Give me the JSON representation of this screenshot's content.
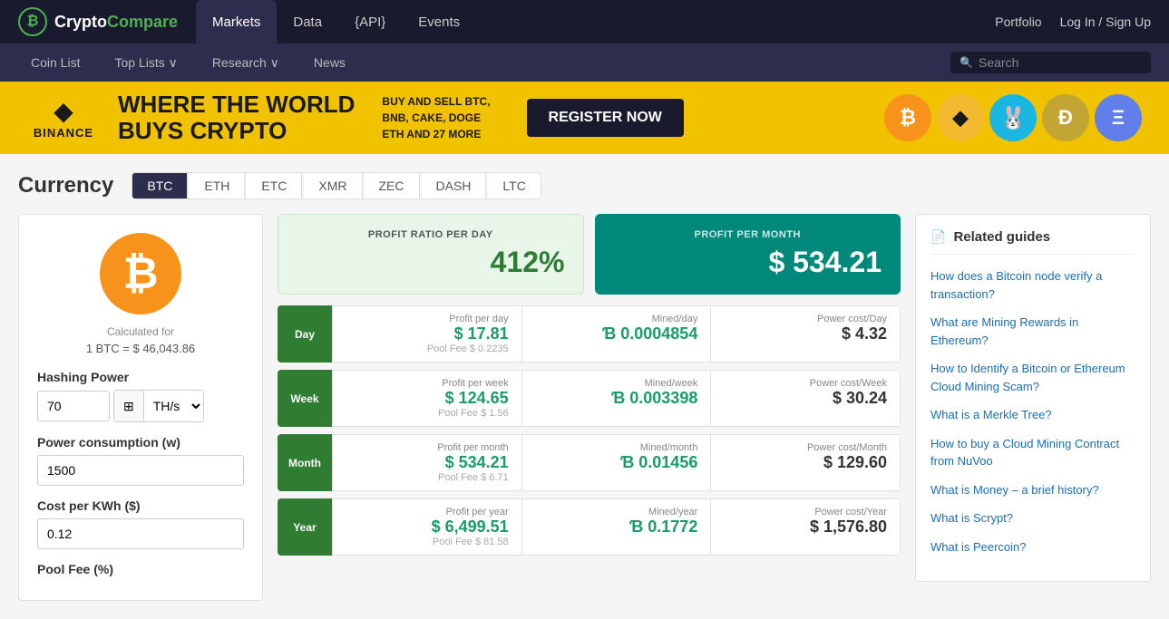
{
  "topNav": {
    "logo": "CryptoCompare",
    "logoPart1": "Crypto",
    "logoPart2": "Compare",
    "logoIcon": "₿",
    "items": [
      {
        "label": "Markets",
        "active": true
      },
      {
        "label": "Data",
        "active": false
      },
      {
        "label": "{API}",
        "active": false
      },
      {
        "label": "Events",
        "active": false
      }
    ],
    "rightLinks": [
      {
        "label": "Portfolio"
      },
      {
        "label": "Log In / Sign Up"
      }
    ]
  },
  "secondaryNav": {
    "items": [
      {
        "label": "Coin List"
      },
      {
        "label": "Top Lists ∨"
      },
      {
        "label": "Research ∨"
      },
      {
        "label": "News"
      }
    ],
    "search": {
      "placeholder": "Search"
    }
  },
  "banner": {
    "brand": "BINANCE",
    "brandIcon": "◆",
    "headline1": "WHERE THE WORLD",
    "headline2": "BUYS CRYPTO",
    "sub": "BUY AND SELL BTC,\nBNB, CAKE, DOGE\nETH AND 27 MORE",
    "cta": "REGISTER NOW",
    "coins": [
      {
        "symbol": "₿",
        "bg": "#f7931a",
        "color": "#fff"
      },
      {
        "symbol": "◆",
        "bg": "#f3ba2f",
        "color": "#1a1a1a"
      },
      {
        "symbol": "🐰",
        "bg": "#1ab5e0",
        "color": "#fff"
      },
      {
        "symbol": "Ð",
        "bg": "#c2a633",
        "color": "#fff"
      },
      {
        "symbol": "Ξ",
        "bg": "#627eea",
        "color": "#fff"
      }
    ]
  },
  "currency": {
    "title": "Currency",
    "tabs": [
      {
        "label": "BTC",
        "active": true
      },
      {
        "label": "ETH",
        "active": false
      },
      {
        "label": "ETC",
        "active": false
      },
      {
        "label": "XMR",
        "active": false
      },
      {
        "label": "ZEC",
        "active": false
      },
      {
        "label": "DASH",
        "active": false
      },
      {
        "label": "LTC",
        "active": false
      }
    ]
  },
  "leftPanel": {
    "btcIcon": "₿",
    "calcFor": "Calculated for",
    "calcRate": "1 BTC = $ 46,043.86",
    "hashingPower": {
      "label": "Hashing Power",
      "value": "70",
      "unit": "TH/s"
    },
    "powerConsumption": {
      "label": "Power consumption (w)",
      "value": "1500"
    },
    "costPerKwh": {
      "label": "Cost per KWh ($)",
      "value": "0.12"
    },
    "poolFee": {
      "label": "Pool Fee (%)"
    }
  },
  "profitSummary": {
    "day": {
      "label": "PROFIT RATIO PER DAY",
      "value": "412%"
    },
    "month": {
      "label": "PROFIT PER MONTH",
      "value": "$ 534.21"
    }
  },
  "dataRows": [
    {
      "period": "Day",
      "profitLabel": "Profit per day",
      "profitValue": "$ 17.81",
      "poolFee": "Pool Fee $ 0.2235",
      "minedLabel": "Mined/day",
      "minedValue": "Ɓ 0.0004854",
      "powerLabel": "Power cost/Day",
      "powerValue": "$ 4.32"
    },
    {
      "period": "Week",
      "profitLabel": "Profit per week",
      "profitValue": "$ 124.65",
      "poolFee": "Pool Fee $ 1.56",
      "minedLabel": "Mined/week",
      "minedValue": "Ɓ 0.003398",
      "powerLabel": "Power cost/Week",
      "powerValue": "$ 30.24"
    },
    {
      "period": "Month",
      "profitLabel": "Profit per month",
      "profitValue": "$ 534.21",
      "poolFee": "Pool Fee $ 6.71",
      "minedLabel": "Mined/month",
      "minedValue": "Ɓ 0.01456",
      "powerLabel": "Power cost/Month",
      "powerValue": "$ 129.60"
    },
    {
      "period": "Year",
      "profitLabel": "Profit per year",
      "profitValue": "$ 6,499.51",
      "poolFee": "Pool Fee $ 81.58",
      "minedLabel": "Mined/year",
      "minedValue": "Ɓ 0.1772",
      "powerLabel": "Power cost/Year",
      "powerValue": "$ 1,576.80"
    }
  ],
  "relatedGuides": {
    "title": "Related guides",
    "icon": "📄",
    "links": [
      {
        "text": "How does a Bitcoin node verify a transaction?"
      },
      {
        "text": "What are Mining Rewards in Ethereum?"
      },
      {
        "text": "How to Identify a Bitcoin or Ethereum Cloud Mining Scam?"
      },
      {
        "text": "What is a Merkle Tree?"
      },
      {
        "text": "How to buy a Cloud Mining Contract from NuVoo"
      },
      {
        "text": "What is Money – a brief history?"
      },
      {
        "text": "What is Scrypt?"
      },
      {
        "text": "What is Peercoin?"
      }
    ]
  }
}
